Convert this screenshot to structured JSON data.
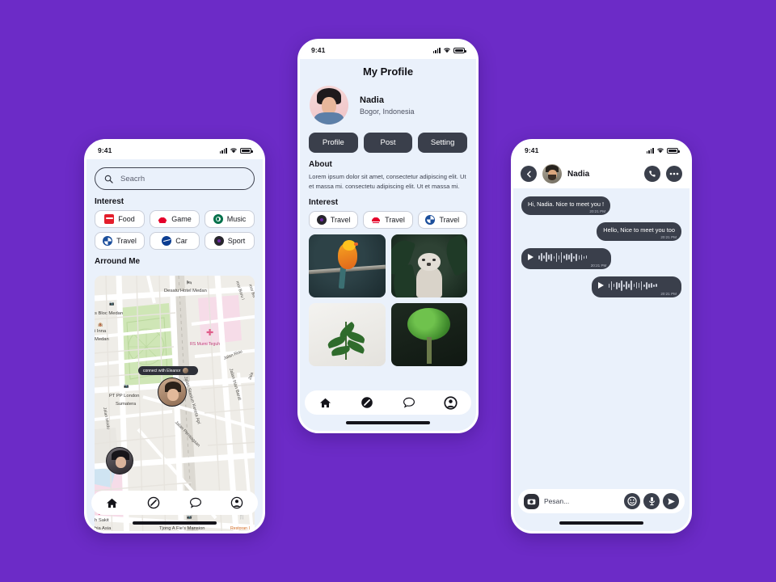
{
  "background_color": "#6C2BC7",
  "screen_bg": "#EAF1FB",
  "accent_dark": "#3A3F4B",
  "status_bar": {
    "time": "9:41",
    "signal": "signal-bars",
    "wifi": "wifi-icon",
    "battery": "battery-icon"
  },
  "phone_map": {
    "search": {
      "placeholder": "Seacrh",
      "value": "",
      "icon": "search-icon"
    },
    "interest_title": "Interest",
    "interest_chips": [
      {
        "label": "Food",
        "icon": "coca-cola-logo-icon"
      },
      {
        "label": "Game",
        "icon": "huawei-logo-icon"
      },
      {
        "label": "Music",
        "icon": "starbucks-logo-icon"
      },
      {
        "label": "Travel",
        "icon": "bmw-logo-icon"
      },
      {
        "label": "Car",
        "icon": "nasa-logo-icon"
      },
      {
        "label": "Sport",
        "icon": "dark-circle-logo-icon"
      }
    ],
    "around_title": "Arround Me",
    "map": {
      "tooltip": "connect with Eleanor",
      "labels": [
        "Desatu Hotel Medan",
        "s Bloc Medan",
        "i Inna",
        "Medan",
        "RS Murni Teguh",
        "Jalan Riau",
        "Jala",
        "PT PP London",
        "Sumatera",
        "Jalan Stasiun Kereta Api",
        "Jalan Irian Barat",
        "Jalan Perniagaan",
        "Jalan Hindu",
        "Tjong A Fie's Mansion",
        "Restoran I",
        "h Sakit",
        "bia Asia",
        "mor Baru I",
        "mor Ba",
        "itar Baru I"
      ],
      "pins": [
        "eleanor-avatar-pin",
        "friend-avatar-pin"
      ]
    },
    "nav": [
      {
        "name": "home",
        "icon": "home-icon",
        "active": true
      },
      {
        "name": "explore",
        "icon": "compass-icon",
        "active": false
      },
      {
        "name": "chat",
        "icon": "chat-bubble-icon",
        "active": false
      },
      {
        "name": "profile",
        "icon": "person-circle-icon",
        "active": false
      }
    ]
  },
  "phone_profile": {
    "title": "My Profile",
    "user": {
      "name": "Nadia",
      "location": "Bogor, Indonesia",
      "avatar": "nadia-avatar"
    },
    "segments": [
      {
        "label": "Profile"
      },
      {
        "label": "Post"
      },
      {
        "label": "Setting"
      }
    ],
    "about_title": "About",
    "about_text": "Lorem ipsum dolor sit amet, consectetur adipiscing elit. Ut et massa mi. consectetu adipiscing elit. Ut et massa mi.",
    "interest_title": "Interest",
    "interest_chips": [
      {
        "label": "Travel",
        "icon": "dark-circle-logo-icon"
      },
      {
        "label": "Travel",
        "icon": "huawei-logo-icon"
      },
      {
        "label": "Travel",
        "icon": "bmw-logo-icon"
      }
    ],
    "photos": [
      {
        "name": "orange-parrot-photo"
      },
      {
        "name": "white-tiger-photo"
      },
      {
        "name": "green-plant-photo"
      },
      {
        "name": "green-bush-photo"
      }
    ],
    "nav": [
      {
        "name": "home",
        "icon": "home-icon",
        "active": false
      },
      {
        "name": "explore",
        "icon": "compass-icon",
        "active": true
      },
      {
        "name": "chat",
        "icon": "chat-bubble-icon",
        "active": false
      },
      {
        "name": "profile",
        "icon": "person-circle-icon",
        "active": true
      }
    ]
  },
  "phone_chat": {
    "header": {
      "back_icon": "chevron-left-icon",
      "avatar": "contact-avatar",
      "name": "Nadia",
      "call_icon": "phone-icon",
      "more_icon": "more-dots-icon"
    },
    "messages": [
      {
        "side": "left",
        "type": "text",
        "text": "Hi, Nadia. Nice to meet you !",
        "time": "20:21 PM"
      },
      {
        "side": "right",
        "type": "text",
        "text": "Hello, Nice to meet you too",
        "time": "20:21 PM"
      },
      {
        "side": "left",
        "type": "voice",
        "text": "",
        "time": "20:21 PM"
      },
      {
        "side": "right",
        "type": "voice",
        "text": "",
        "time": "20:21 PM"
      }
    ],
    "input": {
      "camera_icon": "camera-icon",
      "placeholder": "Pesan...",
      "value": "",
      "emoji_icon": "smiley-icon",
      "mic_icon": "microphone-icon",
      "send_icon": "send-icon"
    }
  }
}
